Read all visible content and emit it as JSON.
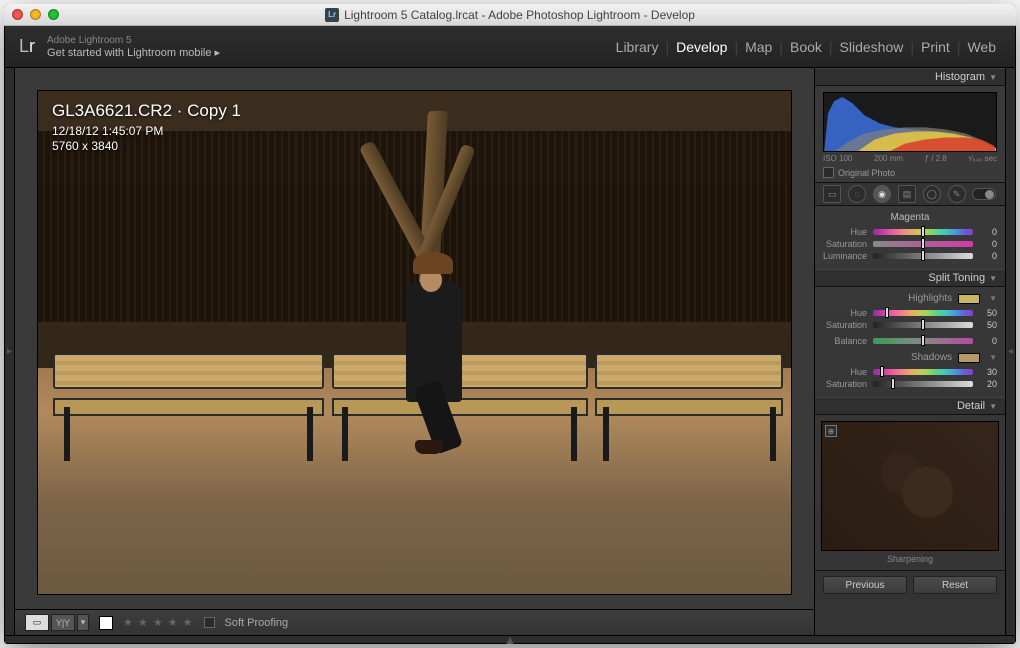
{
  "window": {
    "title": "Lightroom 5 Catalog.lrcat - Adobe Photoshop Lightroom - Develop"
  },
  "identity": {
    "brand_line": "Adobe Lightroom 5",
    "cta": "Get started with Lightroom mobile  ▸"
  },
  "modules": {
    "items": [
      "Library",
      "Develop",
      "Map",
      "Book",
      "Slideshow",
      "Print",
      "Web"
    ],
    "active": "Develop"
  },
  "overlay": {
    "filename": "GL3A6621.CR2 · Copy 1",
    "datetime": "12/18/12 1:45:07 PM",
    "dimensions": "5760 x 3840"
  },
  "histogram": {
    "title": "Histogram",
    "iso": "ISO 100",
    "focal": "200 mm",
    "aperture": "ƒ / 2.8",
    "shutter": "¹⁄₆₄₀ sec",
    "original_label": "Original Photo"
  },
  "hsl": {
    "group": "Magenta",
    "rows": [
      {
        "label": "Hue",
        "value": "0",
        "class": "sl-hue",
        "pos": 50
      },
      {
        "label": "Saturation",
        "value": "0",
        "class": "sl-sat",
        "pos": 50
      },
      {
        "label": "Luminance",
        "value": "0",
        "class": "sl-gray",
        "pos": 50
      }
    ]
  },
  "split": {
    "title": "Split Toning",
    "highlights": {
      "label": "Highlights",
      "swatch": "#c8b862",
      "rows": [
        {
          "label": "Hue",
          "value": "50",
          "class": "sl-hue",
          "pos": 14
        },
        {
          "label": "Saturation",
          "value": "50",
          "class": "sl-gray",
          "pos": 50
        }
      ]
    },
    "balance": {
      "label": "Balance",
      "value": "0",
      "class": "sl-bal",
      "pos": 50
    },
    "shadows": {
      "label": "Shadows",
      "swatch": "#b89a6a",
      "rows": [
        {
          "label": "Hue",
          "value": "30",
          "class": "sl-hue",
          "pos": 9
        },
        {
          "label": "Saturation",
          "value": "20",
          "class": "sl-gray",
          "pos": 20
        }
      ]
    }
  },
  "detail": {
    "title": "Detail",
    "cutoff": "Sharpening"
  },
  "toolbar": {
    "soft_proof": "Soft Proofing"
  },
  "buttons": {
    "previous": "Previous",
    "reset": "Reset"
  }
}
